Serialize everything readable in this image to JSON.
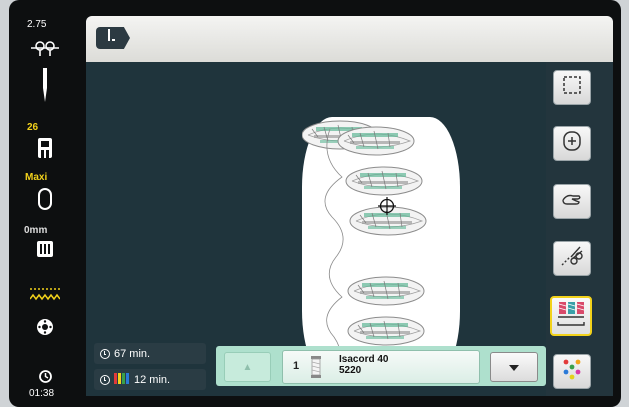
{
  "status_bar": {
    "top_value": "2.75",
    "stitch_length": "26",
    "presser_foot": "Maxi",
    "offset": "0mm",
    "clock_time": "01:38",
    "icons": [
      "tension-icon",
      "needle-icon",
      "presser-foot-icon",
      "hoop-icon",
      "feed-dog-icon",
      "stitch-pattern-icon",
      "bobbin-icon",
      "clock-icon"
    ]
  },
  "header": {
    "back_icon": "needle-back-icon"
  },
  "design": {
    "motif": "embroidery-leaf-motifs",
    "crosshair_icon": "center-crosshair-icon"
  },
  "tools": [
    {
      "name": "select-area-tool",
      "icon": "dashed-square-icon"
    },
    {
      "name": "hoop-center-tool",
      "icon": "hoop-center-icon"
    },
    {
      "name": "move-design-tool",
      "icon": "hand-icon"
    },
    {
      "name": "thread-cut-tool",
      "icon": "scissors-icon"
    },
    {
      "name": "color-sequence-tool",
      "icon": "thread-colors-icon",
      "active": true
    },
    {
      "name": "color-palette-tool",
      "icon": "color-dots-icon"
    }
  ],
  "timing": {
    "total_time": "67 min.",
    "color_time": "12 min."
  },
  "thread": {
    "index": "1",
    "brand": "Isacord 40",
    "code": "5220",
    "up_icon": "arrow-up-icon",
    "down_icon": "arrow-down-icon"
  },
  "colors": {
    "accent": "#f2d21b",
    "panel_bg": "#23353d",
    "thread_bar": "#aee0cd",
    "thread_green": "#3a9e7a"
  }
}
